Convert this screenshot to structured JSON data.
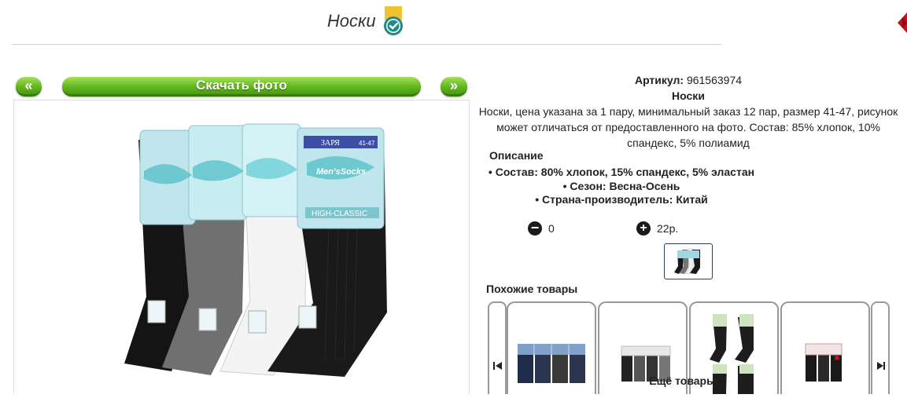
{
  "header": {
    "title": "Носки",
    "icons": {
      "verified": "verified-check-icon",
      "close": "close-arrow-icon"
    }
  },
  "gallery": {
    "prev_label": "«",
    "download_label": "Скачать фото",
    "next_label": "»"
  },
  "product": {
    "article_label": "Артикул:",
    "article_value": "961563974",
    "name": "Носки",
    "summary": "Носки, цена указана за 1 пару, минимальный заказ 12 пар, размер 41-47, рисунок может отличаться от предоставленного на фото. Состав: 85% хлопок, 10% спандекс, 5% полиамид",
    "description_heading": "Описание",
    "attributes": [
      "Состав: 80% хлопок, 15% спандекс, 5% эластан",
      "Сезон: Весна-Осень",
      "Страна-производитель: Китай"
    ],
    "quantity": "0",
    "price": "22р.",
    "qty_minus_label": "−",
    "qty_plus_label": "+"
  },
  "packaging_text": {
    "brand": "ЗАРЯ",
    "logo": "Men'sSocks",
    "series": "HIGH-CLASSIC",
    "size": "41-47"
  },
  "similar": {
    "heading": "Похожие товары",
    "more_label": "Ещё товары:",
    "nav_icons": [
      "skip-previous-icon",
      "skip-next-icon"
    ]
  },
  "colors": {
    "accent_green": "#62b81f",
    "dark_border": "#2a3e63",
    "verified_yellow": "#f2c230",
    "verified_teal": "#1f8a8a",
    "close_red": "#c1121f"
  }
}
